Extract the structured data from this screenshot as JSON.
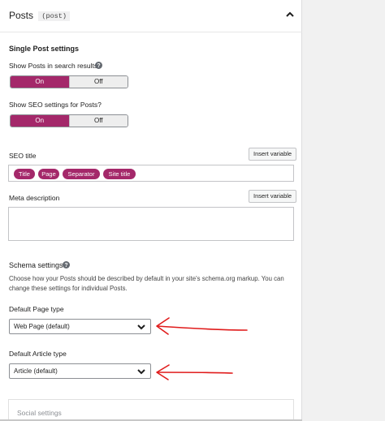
{
  "header": {
    "title": "Posts",
    "code": "post"
  },
  "single_post": {
    "heading": "Single Post settings",
    "search_label": "Show Posts in search results?",
    "search_toggle": {
      "on": "On",
      "off": "Off",
      "selected": "On"
    },
    "seo_label": "Show SEO settings for Posts?",
    "seo_toggle": {
      "on": "On",
      "off": "Off",
      "selected": "On"
    }
  },
  "seo_title": {
    "label": "SEO title",
    "insert_variable": "Insert variable",
    "tokens": [
      "Title",
      "Page",
      "Separator",
      "Site title"
    ]
  },
  "meta_description": {
    "label": "Meta description",
    "insert_variable": "Insert variable"
  },
  "schema": {
    "heading": "Schema settings",
    "description_line1": "Choose how your Posts should be described by default in your site's schema.org markup. You can",
    "description_line2": "change these settings for individual Posts.",
    "page_type_label": "Default Page type",
    "page_type_value": "Web Page (default)",
    "article_type_label": "Default Article type",
    "article_type_value": "Article (default)"
  },
  "social": {
    "label": "Social settings"
  },
  "colors": {
    "accent": "#a4286a",
    "annotation_arrow": "#e01b1b"
  },
  "icons": {
    "collapse": "chevron-up-icon",
    "help": "help-circle-icon",
    "select": "chevron-down-icon"
  }
}
